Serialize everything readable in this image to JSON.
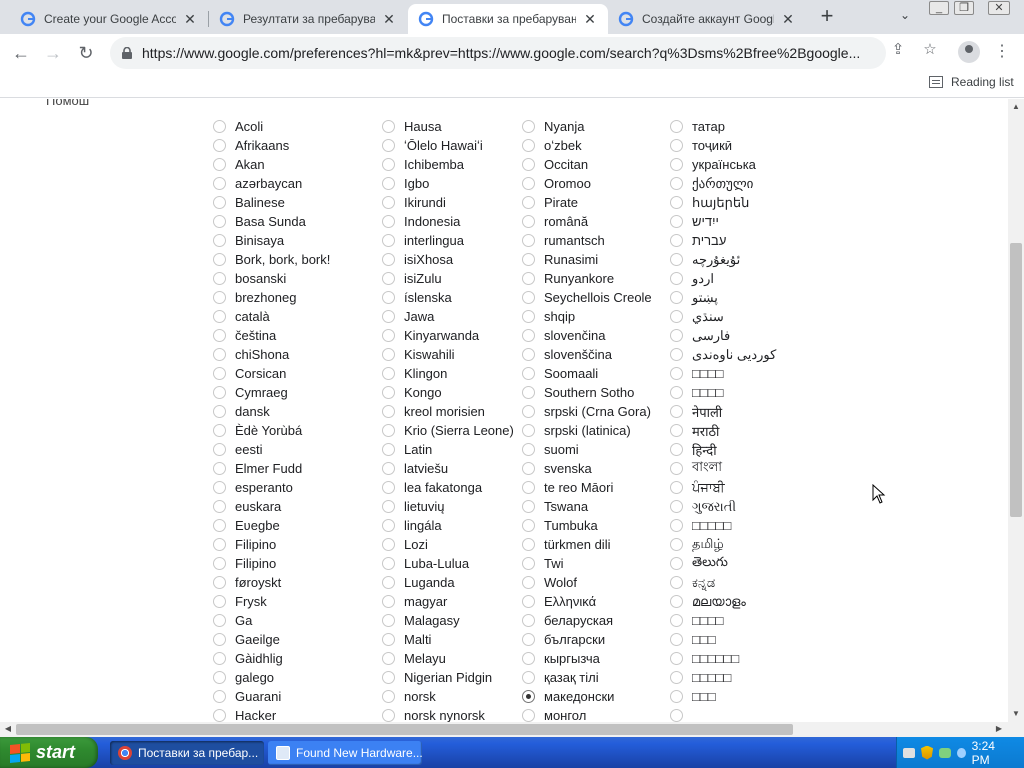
{
  "tabs": [
    {
      "label": "Create your Google Account",
      "active": false
    },
    {
      "label": "Резултати за пребарување - Справ",
      "active": false
    },
    {
      "label": "Поставки за пребарување",
      "active": true
    },
    {
      "label": "Создайте аккаунт Google",
      "active": false
    }
  ],
  "url": "https://www.google.com/preferences?hl=mk&prev=https://www.google.com/search?q%3Dsms%2Bfree%2Bgoogle...",
  "reading_list": "Reading list",
  "back_link": "Помош",
  "columns": [
    [
      "Acoli",
      "Afrikaans",
      "Akan",
      "azərbaycan",
      "Balinese",
      "Basa Sunda",
      "Binisaya",
      "Bork, bork, bork!",
      "bosanski",
      "brezhoneg",
      "català",
      "čeština",
      "chiShona",
      "Corsican",
      "Cymraeg",
      "dansk",
      "Èdè Yorùbá",
      "eesti",
      "Elmer Fudd",
      "esperanto",
      "euskara",
      "Eʋegbe",
      "Filipino",
      "Filipino",
      "føroyskt",
      "Frysk",
      "Ga",
      "Gaeilge",
      "Gàidhlig",
      "galego",
      "Guarani",
      "Hacker"
    ],
    [
      "Hausa",
      "ʻŌlelo Hawaiʻi",
      "Ichibemba",
      "Igbo",
      "Ikirundi",
      "Indonesia",
      "interlingua",
      "isiXhosa",
      "isiZulu",
      "íslenska",
      "Jawa",
      "Kinyarwanda",
      "Kiswahili",
      "Klingon",
      "Kongo",
      "kreol morisien",
      "Krio (Sierra Leone)",
      "Latin",
      "latviešu",
      "lea fakatonga",
      "lietuvių",
      "lingála",
      "Lozi",
      "Luba-Lulua",
      "Luganda",
      "magyar",
      "Malagasy",
      "Malti",
      "Melayu",
      "Nigerian Pidgin",
      "norsk",
      "norsk nynorsk"
    ],
    [
      "Nyanja",
      "oʻzbek",
      "Occitan",
      "Oromoo",
      "Pirate",
      "română",
      "rumantsch",
      "Runasimi",
      "Runyankore",
      "Seychellois Creole",
      "shqip",
      "slovenčina",
      "slovenščina",
      "Soomaali",
      "Southern Sotho",
      "srpski (Crna Gora)",
      "srpski (latinica)",
      "suomi",
      "svenska",
      "te reo Māori",
      "Tswana",
      "Tumbuka",
      "türkmen dili",
      "Twi",
      "Wolof",
      "Ελληνικά",
      "беларуская",
      "български",
      "кыргызча",
      "қазақ тілі",
      "македонски",
      "монгол"
    ],
    [
      "татар",
      "тоҷикӣ",
      "українська",
      "ქართული",
      "հայերեն",
      "ייִדיש",
      "עברית",
      "ئۇيغۇرچە",
      "اردو",
      "پښتو",
      "سنڌي",
      "فارسی",
      "کوردیی ناوەندی",
      "□□□□",
      "□□□□",
      "नेपाली",
      "मराठी",
      "हिन्दी",
      "বাংলা",
      "ਪੰਜਾਬੀ",
      "ગુજરાતી",
      "□□□□□",
      "தமிழ்",
      "తెలుగు",
      "ಕನ್ನಡ",
      "മലയാളം",
      "□□□□",
      "□□□",
      "□□□□□□",
      "□□□□□",
      "□□□",
      ""
    ]
  ],
  "selected_language": "македонски",
  "taskbar": {
    "start": "start",
    "items": [
      {
        "label": "Поставки за пребар...",
        "active": true
      },
      {
        "label": "Found New Hardware...",
        "active": false
      }
    ],
    "clock": "3:24 PM"
  },
  "colors": {
    "tabbar": "#dee1e6",
    "taskbar": "#245edb",
    "start": "#2f8a2f",
    "tray": "#0f8ae5"
  }
}
